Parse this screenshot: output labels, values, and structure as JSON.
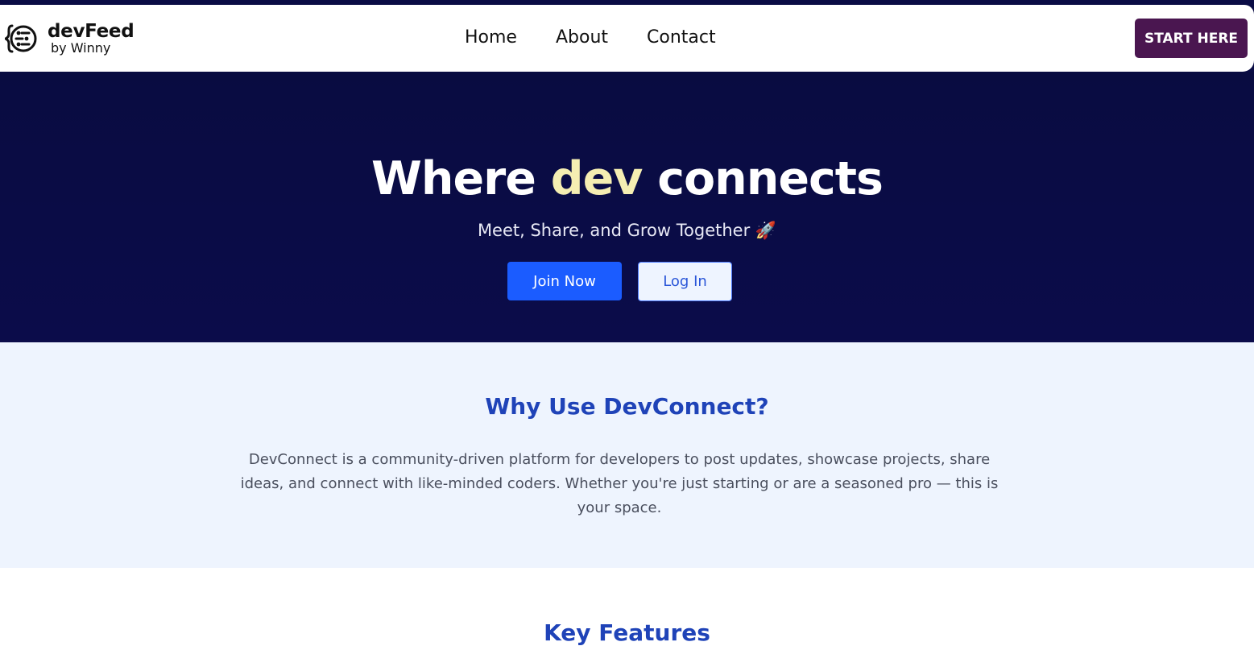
{
  "brand": {
    "name": "devFeed",
    "tagline": "by Winny",
    "icon": "brace-chat-icon"
  },
  "nav": {
    "links": [
      "Home",
      "About",
      "Contact"
    ],
    "cta_label": "START HERE"
  },
  "hero": {
    "title_pre": "Where ",
    "title_accent": "dev",
    "title_post": " connects",
    "subtitle": "Meet, Share, and Grow Together",
    "subtitle_emoji": "🚀",
    "join_label": "Join Now",
    "login_label": "Log In"
  },
  "why": {
    "title": "Why Use DevConnect?",
    "text": "DevConnect is a community-driven platform for developers to post updates, showcase projects, share ideas, and connect with like-minded coders. Whether you're just starting or are a seasoned pro — this is your space."
  },
  "features": {
    "title": "Key Features"
  },
  "colors": {
    "navy": "#0a0c45",
    "accent_yellow": "#f5eeb2",
    "primary_blue": "#1b5cff",
    "cta_purple": "#4a1650",
    "section_bg": "#eef4fe",
    "heading_blue": "#1f43b8"
  }
}
